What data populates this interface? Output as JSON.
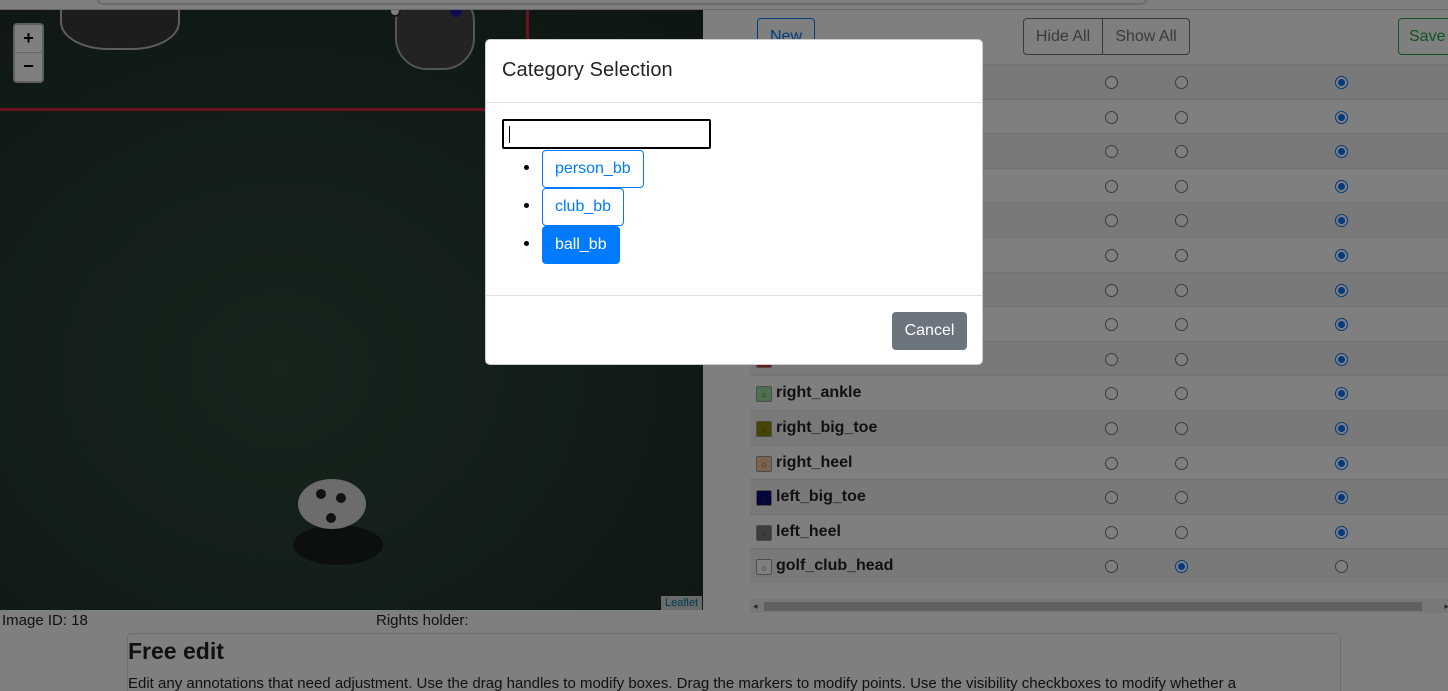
{
  "map": {
    "zoom_in": "+",
    "zoom_out": "−",
    "attribution": "Leaflet"
  },
  "image_info": {
    "image_id": "Image ID: 18",
    "rights_holder": "Rights holder:"
  },
  "free_edit": {
    "title": "Free edit",
    "text": "Edit any annotations that need adjustment. Use the drag handles to modify boxes. Drag the markers to modify points. Use the visibility checkboxes to modify whether a"
  },
  "toolbar": {
    "new_label": "New",
    "hide_all_label": "Hide All",
    "show_all_label": "Show All",
    "save_label": "Save"
  },
  "annotations": [
    {
      "name": "",
      "color": "#ffffff",
      "selected": 3
    },
    {
      "name": "",
      "color": "#ffffff",
      "selected": 3
    },
    {
      "name": "",
      "color": "#ffffff",
      "selected": 3
    },
    {
      "name": "",
      "color": "#ffffff",
      "selected": 3
    },
    {
      "name": "",
      "color": "#ffffff",
      "selected": 3
    },
    {
      "name": "",
      "color": "#ffffff",
      "selected": 3
    },
    {
      "name": "",
      "color": "#ffffff",
      "selected": 3
    },
    {
      "name": "",
      "color": "#ffffff",
      "selected": 3
    },
    {
      "name": "",
      "color": "#c0392b",
      "selected": 3
    },
    {
      "name": "right_ankle",
      "color": "#9fe0a0",
      "selected": 3
    },
    {
      "name": "right_big_toe",
      "color": "#8a8a00",
      "selected": 3
    },
    {
      "name": "right_heel",
      "color": "#f5c49a",
      "selected": 3
    },
    {
      "name": "left_big_toe",
      "color": "#0a0a7a",
      "selected": 3
    },
    {
      "name": "left_heel",
      "color": "#7a7a7a",
      "selected": 3
    },
    {
      "name": "golf_club_head",
      "color": "#ffffff",
      "selected": 2
    }
  ],
  "modal": {
    "title": "Category Selection",
    "search_value": "",
    "categories": [
      {
        "label": "person_bb",
        "active": false
      },
      {
        "label": "club_bb",
        "active": false
      },
      {
        "label": "ball_bb",
        "active": true
      }
    ],
    "cancel_label": "Cancel"
  }
}
